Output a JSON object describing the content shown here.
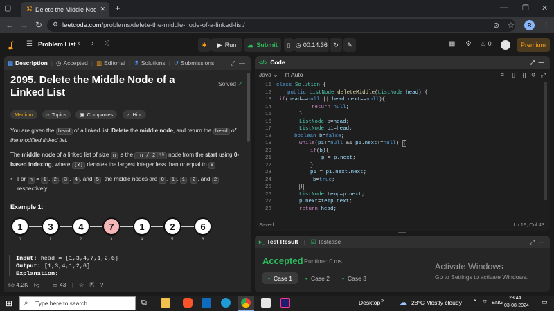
{
  "browser": {
    "tab_title": "Delete the Middle Node of a Li",
    "url_host": "leetcode.com",
    "url_path": "/problems/delete-the-middle-node-of-a-linked-list/",
    "profile_initial": "R"
  },
  "header": {
    "problem_list": "Problem List",
    "run": "Run",
    "submit": "Submit",
    "timer": "00:14:36",
    "streak": "0",
    "premium": "Premium"
  },
  "left_tabs": [
    "Description",
    "Accepted",
    "Editorial",
    "Solutions",
    "Submissions"
  ],
  "problem": {
    "title": "2095. Delete the Middle Node of a Linked List",
    "solved": "Solved",
    "chips": [
      "Medium",
      "Topics",
      "Companies",
      "Hint"
    ],
    "p1_a": "You are given the ",
    "p1_code": "head",
    "p1_b": " of a linked list. ",
    "p1_c": "Delete",
    "p1_d": " the ",
    "p1_e": "middle node",
    "p1_f": ", and return the ",
    "p1_code2": "head",
    "p1_g": " of the modified linked list.",
    "p2_a": "The ",
    "p2_b": "middle node",
    "p2_c": " of a linked list of size ",
    "p2_n": "n",
    "p2_d": " is the ",
    "p2_floor": "⌊n / 2⌋ᵗʰ",
    "p2_e": " node from the ",
    "p2_f": "start",
    "p2_g": " using ",
    "p2_h": "0-based indexing",
    "p2_i": ", where ",
    "p2_x": "⌊x⌋",
    "p2_j": " denotes the largest integer less than or equal to ",
    "p2_x2": "x",
    "p2_k": ".",
    "bullet_a": "For ",
    "bullet_n": "n",
    "bullet_b": " = ",
    "bullet_vals": [
      "1",
      "2",
      "3",
      "4",
      "5"
    ],
    "bullet_c": ", the middle nodes are ",
    "bullet_mids": [
      "0",
      "1",
      "1",
      "2",
      "2"
    ],
    "bullet_d": ", respectively.",
    "example_title": "Example 1:",
    "nodes": [
      "1",
      "3",
      "4",
      "7",
      "1",
      "2",
      "6"
    ],
    "indices": [
      "0",
      "1",
      "2",
      "3",
      "4",
      "5",
      "6"
    ],
    "input_label": "Input:",
    "input_value": " head = [1,3,4,7,1,2,6]",
    "output_label": "Output:",
    "output_value": " [1,3,4,1,2,6]",
    "explanation_label": "Explanation:"
  },
  "left_footer": {
    "likes": "4.2K",
    "comments": "43"
  },
  "code": {
    "title": "Code",
    "language": "Java",
    "auto": "Auto",
    "line_numbers": [
      "11",
      "12",
      "13",
      "14",
      "15",
      "16",
      "17",
      "18",
      "19",
      "20",
      "21",
      "22",
      "23",
      "24",
      "25",
      "26",
      "27",
      "28"
    ],
    "saved": "Saved",
    "cursor": "Ln 19, Col 43"
  },
  "result": {
    "tab_result": "Test Result",
    "tab_testcase": "Testcase",
    "status": "Accepted",
    "runtime": "Runtime: 0 ms",
    "cases": [
      "Case 1",
      "Case 2",
      "Case 3"
    ],
    "watermark_title": "Activate Windows",
    "watermark_sub": "Go to Settings to activate Windows."
  },
  "taskbar": {
    "search_placeholder": "Type here to search",
    "desktop": "Desktop",
    "weather": "28°C  Mostly cloudy",
    "lang": "ENG",
    "time": "23:44",
    "date": "03-08-2024"
  },
  "colors": {
    "accepted": "#2cbb5d",
    "submit": "#2cbb5d",
    "premium": "#ffa116",
    "medium": "#ffb800",
    "middle_node": "#f4b6b6"
  }
}
